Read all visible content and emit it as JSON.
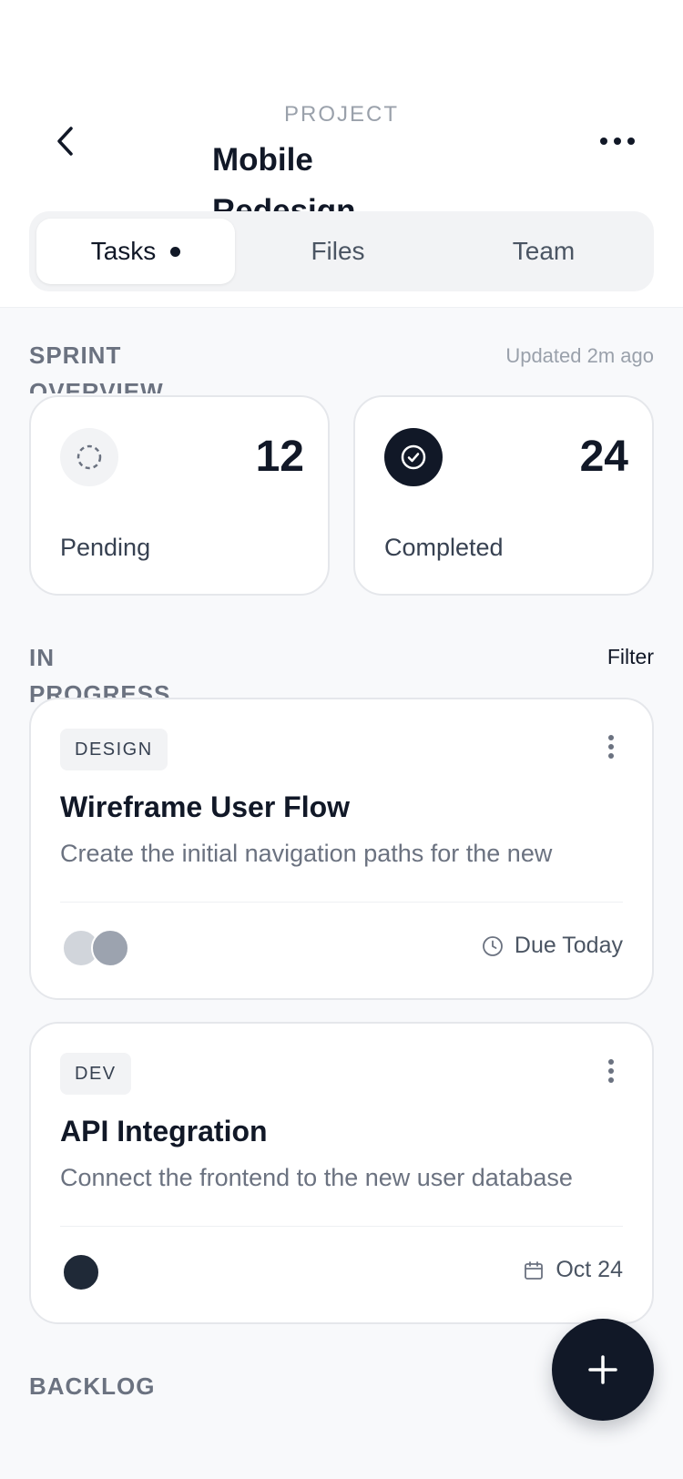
{
  "header": {
    "eyebrow": "PROJECT",
    "title": "Mobile Redesign",
    "back_icon": "chevron-left-icon",
    "more_icon": "more-horizontal-icon"
  },
  "tabs": [
    {
      "label": "Tasks",
      "active": true
    },
    {
      "label": "Files",
      "active": false
    },
    {
      "label": "Team",
      "active": false
    }
  ],
  "overview": {
    "label": "SPRINT OVERVIEW",
    "updated": "Updated 2m ago",
    "stats": [
      {
        "value": "12",
        "label": "Pending",
        "icon": "dashed-circle-icon"
      },
      {
        "value": "24",
        "label": "Completed",
        "icon": "check-circle-icon"
      }
    ]
  },
  "in_progress": {
    "label": "IN PROGRESS",
    "filter": "Filter",
    "tasks": [
      {
        "tag": "DESIGN",
        "title": "Wireframe User Flow",
        "description": "Create the initial navigation paths for the new",
        "due": "Due Today",
        "due_icon": "clock-icon"
      },
      {
        "tag": "DEV",
        "title": "API Integration",
        "description": "Connect the frontend to the new user database",
        "due": "Oct 24",
        "due_icon": "calendar-icon"
      }
    ]
  },
  "backlog": {
    "label": "BACKLOG"
  },
  "fab_icon": "plus-icon",
  "colors": {
    "primary": "#111827",
    "muted": "#6b7280",
    "surface": "#ffffff",
    "background": "#f8f9fb",
    "avatar_light": "#d1d5db",
    "avatar_mid": "#9ca3af",
    "avatar_dark": "#1f2937"
  }
}
